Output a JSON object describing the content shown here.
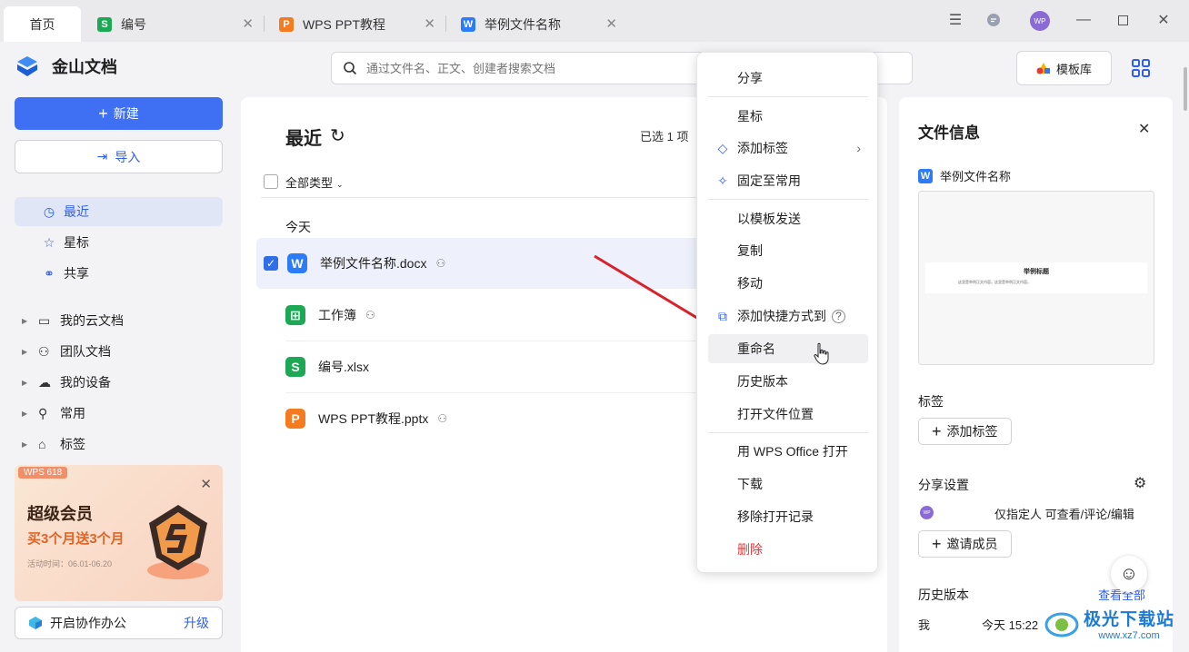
{
  "tabs": [
    {
      "label": "首页"
    },
    {
      "label": "编号",
      "icon": "S"
    },
    {
      "label": "WPS PPT教程",
      "icon": "P"
    },
    {
      "label": "举例文件名称",
      "icon": "W"
    }
  ],
  "app": {
    "name": "金山文档"
  },
  "search": {
    "placeholder": "通过文件名、正文、创建者搜索文档"
  },
  "header": {
    "template_label": "模板库"
  },
  "sidebar": {
    "new_label": "新建",
    "import_label": "导入",
    "nav": [
      {
        "label": "最近"
      },
      {
        "label": "星标"
      },
      {
        "label": "共享"
      }
    ],
    "tree": [
      {
        "label": "我的云文档"
      },
      {
        "label": "团队文档"
      },
      {
        "label": "我的设备"
      },
      {
        "label": "常用"
      },
      {
        "label": "标签"
      }
    ],
    "promo": {
      "badge": "WPS 618",
      "title": "超级会员",
      "subtitle": "买3个月送3个月",
      "date": "活动时间：06.01-06.20"
    },
    "collab_label": "开启协作办公",
    "upgrade_label": "升级"
  },
  "main": {
    "title": "最近",
    "selected_count": "已选 1 项",
    "filter_label": "全部类型",
    "group_label": "今天",
    "files": [
      {
        "name": "举例文件名称.docx",
        "icon": "W",
        "shared": true
      },
      {
        "name": "工作簿",
        "icon": "⊞",
        "shared": true
      },
      {
        "name": "编号.xlsx",
        "icon": "S",
        "shared": false
      },
      {
        "name": "WPS PPT教程.pptx",
        "icon": "P",
        "shared": true
      }
    ]
  },
  "menu": {
    "items": [
      "分享",
      "星标",
      "添加标签",
      "固定至常用",
      "以模板发送",
      "复制",
      "移动",
      "添加快捷方式到",
      "重命名",
      "历史版本",
      "打开文件位置",
      "用 WPS Office 打开",
      "下载",
      "移除打开记录",
      "删除"
    ],
    "danger_color": "#e5383b"
  },
  "info": {
    "title": "文件信息",
    "file_name": "举例文件名称",
    "preview_title": "举例标题",
    "preview_body": "这里是举例正文内容。这里是举例正文内容。",
    "tags_label": "标签",
    "add_tag_label": "添加标签",
    "share_label": "分享设置",
    "share_scope": "仅指定人 可查看/评论/编辑",
    "invite_label": "邀请成员",
    "history_label": "历史版本",
    "view_all": "查看全部",
    "history_user": "我",
    "history_time": "今天 15:22",
    "avatar_text": "WP"
  },
  "watermark": {
    "site": "极光下载站",
    "url": "www.xz7.com"
  },
  "colors": {
    "accent": "#3f6ff2",
    "arrow": "#d9222a"
  }
}
